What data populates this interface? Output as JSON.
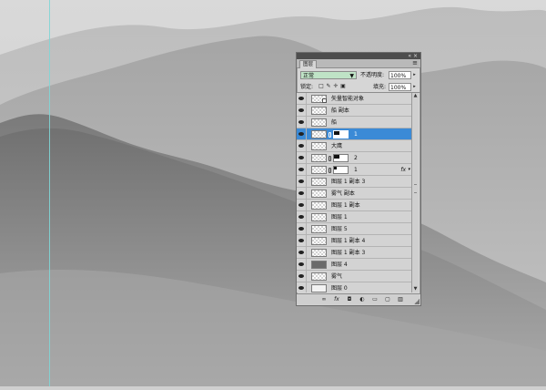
{
  "panel": {
    "collapse_icon": "double-arrow-icon",
    "close_icon": "close-icon",
    "tab_label": "图层",
    "menu_icon": "panel-menu-icon"
  },
  "blend_mode": {
    "value": "正常"
  },
  "opacity": {
    "label": "不透明度:",
    "value": "100%"
  },
  "lock": {
    "label": "锁定:"
  },
  "fill": {
    "label": "填充:",
    "value": "100%"
  },
  "layers": [
    {
      "name": "矢量智能对象",
      "type": "smart",
      "visible": true
    },
    {
      "name": "船 副本",
      "type": "pixel",
      "visible": true
    },
    {
      "name": "船",
      "type": "pixel",
      "visible": true
    },
    {
      "name": "1",
      "type": "masked",
      "visible": true,
      "selected": true
    },
    {
      "name": "大鹰",
      "type": "pixel",
      "visible": true
    },
    {
      "name": "2",
      "type": "masked",
      "visible": true
    },
    {
      "name": "1",
      "type": "masked",
      "visible": true,
      "fx": "fx"
    },
    {
      "name": "图层 1 副本 3",
      "type": "pixel",
      "visible": true
    },
    {
      "name": "雾气 副本",
      "type": "pixel",
      "visible": true
    },
    {
      "name": "图层 1 副本",
      "type": "pixel",
      "visible": true
    },
    {
      "name": "图层 1",
      "type": "pixel",
      "visible": true
    },
    {
      "name": "图层 5",
      "type": "pixel",
      "visible": true
    },
    {
      "name": "图层 1 副本 4",
      "type": "pixel",
      "visible": true
    },
    {
      "name": "图层 1 副本 3",
      "type": "pixel",
      "visible": true
    },
    {
      "name": "图层 4",
      "type": "dark",
      "visible": true
    },
    {
      "name": "雾气",
      "type": "pixel",
      "visible": true
    },
    {
      "name": "图层 0",
      "type": "white",
      "visible": true
    }
  ],
  "bottom_icons": [
    "link-icon",
    "fx-icon",
    "mask-icon",
    "adjustment-icon",
    "folder-icon",
    "new-layer-icon",
    "trash-icon"
  ],
  "colors": {
    "selected_row": "#3b8ad6",
    "blend_field": "#bfe3c6",
    "guide": "#7fd6d6"
  }
}
